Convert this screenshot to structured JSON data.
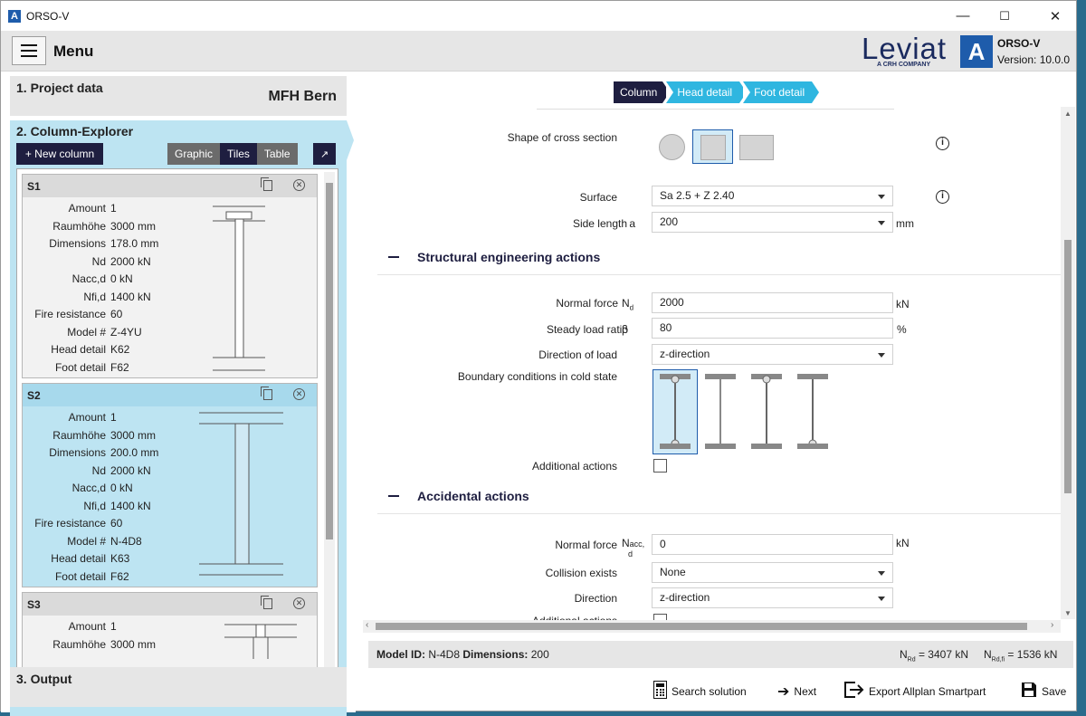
{
  "window": {
    "title": "ORSO-V",
    "logo": "A",
    "min": "—",
    "max": "☐",
    "close": "✕"
  },
  "header": {
    "menu_label": "Menu",
    "brand": "Leviat",
    "brand_sub": "A CRH COMPANY",
    "app_logo": "A",
    "app_name": "ORSO-V",
    "version": "Version: 10.0.0"
  },
  "sidebar": {
    "project": {
      "title": "1. Project data",
      "value": "MFH Bern"
    },
    "explorer": {
      "title": "2. Column-Explorer",
      "new_column": "+ New column",
      "views": [
        "Graphic",
        "Tiles",
        "Table"
      ],
      "active_view": "Tiles",
      "expand_icon": "↗"
    },
    "output": {
      "title": "3. Output"
    },
    "columns": [
      {
        "id": "S1",
        "rows": [
          [
            "Amount",
            "1"
          ],
          [
            "Raumhöhe",
            "3000 mm"
          ],
          [
            "Dimensions",
            "178.0 mm"
          ],
          [
            "Nd",
            "2000 kN"
          ],
          [
            "Nacc,d",
            "0 kN"
          ],
          [
            "Nfi,d",
            "1400 kN"
          ],
          [
            "Fire resistance",
            "60"
          ],
          [
            "Model #",
            "Z-4YU"
          ],
          [
            "Head detail",
            "K62"
          ],
          [
            "Foot detail",
            "F62"
          ]
        ]
      },
      {
        "id": "S2",
        "rows": [
          [
            "Amount",
            "1"
          ],
          [
            "Raumhöhe",
            "3000 mm"
          ],
          [
            "Dimensions",
            "200.0 mm"
          ],
          [
            "Nd",
            "2000 kN"
          ],
          [
            "Nacc,d",
            "0 kN"
          ],
          [
            "Nfi,d",
            "1400 kN"
          ],
          [
            "Fire resistance",
            "60"
          ],
          [
            "Model #",
            "N-4D8"
          ],
          [
            "Head detail",
            "K63"
          ],
          [
            "Foot detail",
            "F62"
          ]
        ]
      },
      {
        "id": "S3",
        "rows": [
          [
            "Amount",
            "1"
          ],
          [
            "Raumhöhe",
            "3000 mm"
          ]
        ]
      }
    ]
  },
  "breadcrumbs": [
    "Column",
    "Head detail",
    "Foot detail"
  ],
  "form": {
    "shape_label": "Shape of cross section",
    "surface_label": "Surface",
    "surface_value": "Sa 2.5 + Z 2.40",
    "side_label": "Side length",
    "side_sub": "a",
    "side_value": "200",
    "side_unit": "mm",
    "sect1": "Structural engineering actions",
    "nd_label": "Normal force",
    "nd_sym": "N",
    "nd_sub": "d",
    "nd_value": "2000",
    "nd_unit": "kN",
    "beta_label": "Steady load ratio",
    "beta_sym": "β",
    "beta_value": "80",
    "beta_unit": "%",
    "dir_label": "Direction of load",
    "dir_value": "z-direction",
    "bc_label": "Boundary conditions in cold state",
    "add_label": "Additional actions",
    "sect2": "Accidental actions",
    "nacc_label": "Normal force",
    "nacc_sym": "N",
    "nacc_sub": "acc,",
    "nacc_sub2": "d",
    "nacc_value": "0",
    "nacc_unit": "kN",
    "coll_label": "Collision exists",
    "coll_value": "None",
    "dir2_label": "Direction",
    "dir2_value": "z-direction",
    "add2_label": "Additional actions",
    "info_icon": "i"
  },
  "status": {
    "model_label": "Model ID:",
    "model_value": "N-4D8",
    "dim_label": "Dimensions:",
    "dim_value": "200",
    "nrd": "N",
    "nrd_sub": "Rd",
    "nrd_value": "= 3407 kN",
    "nrdfi": "N",
    "nrdfi_sub": "Rd,fi",
    "nrdfi_value": "= 1536 kN"
  },
  "actions": {
    "search": "Search solution",
    "next": "Next",
    "export": "Export Allplan Smartpart",
    "save": "Save"
  }
}
